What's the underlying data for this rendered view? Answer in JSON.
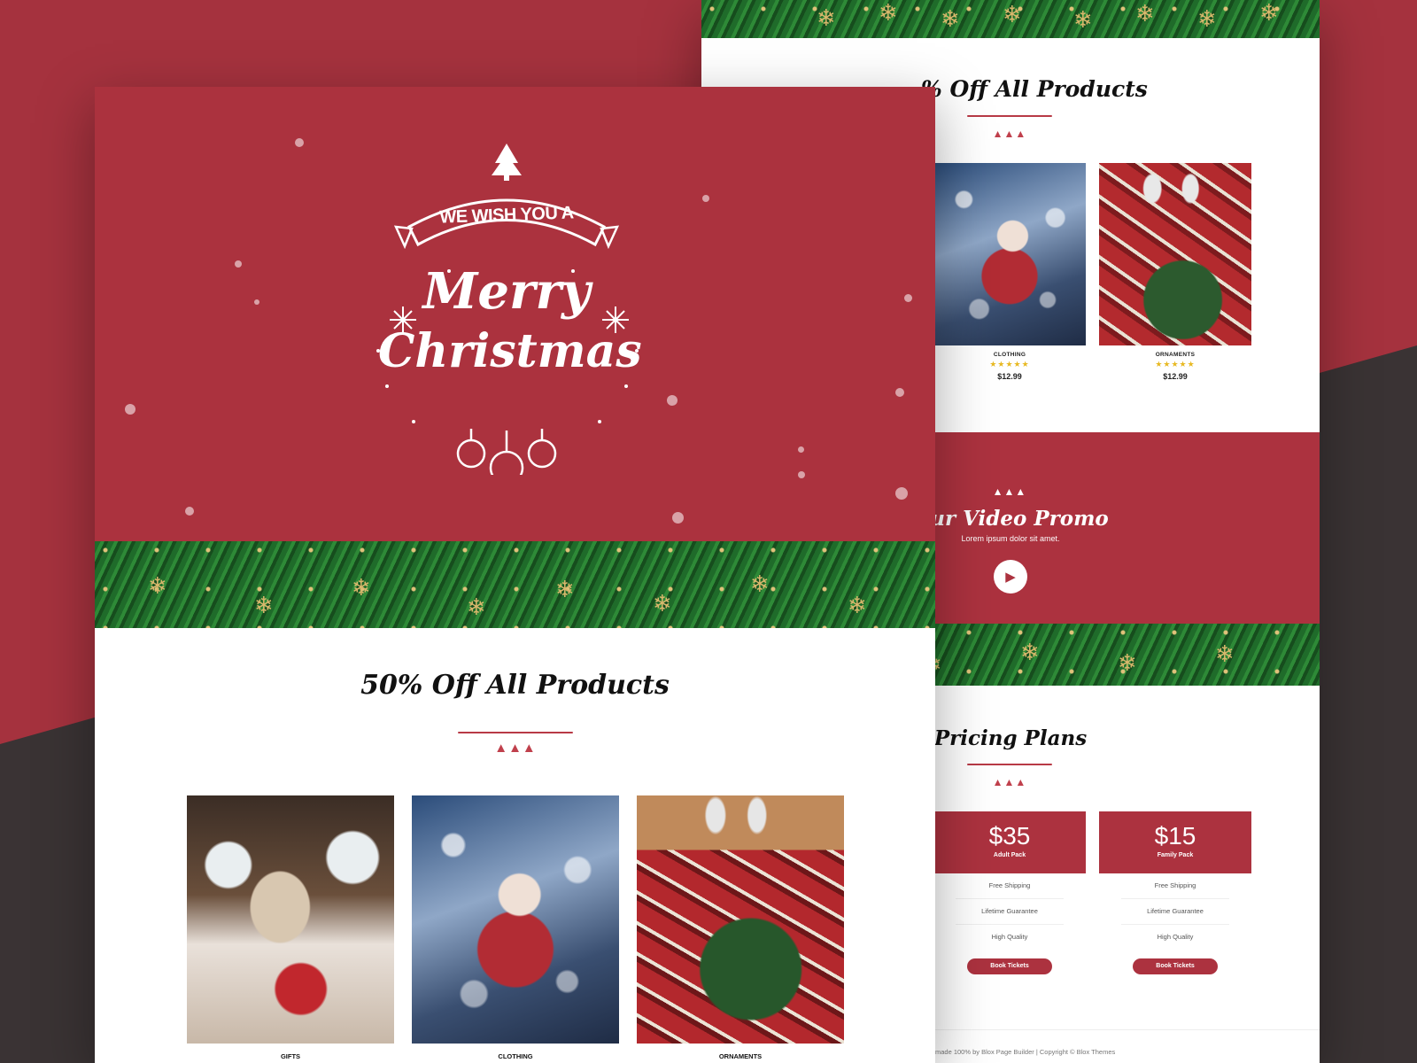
{
  "colors": {
    "brand_red": "#ab323e",
    "dark": "#3a3334",
    "gold": "#e8b923"
  },
  "back_page": {
    "sale_title": "% Off All Products",
    "products": [
      {
        "category": "CLOTHING",
        "rating": "★★★★★",
        "price": "$12.99"
      },
      {
        "category": "ORNAMENTS",
        "rating": "★★★★★",
        "price": "$12.99"
      }
    ],
    "video": {
      "title": "Our Video Promo",
      "subtitle": "Lorem ipsum dolor sit amet.",
      "play_icon": "play-icon"
    },
    "pricing": {
      "title": "Pricing Plans",
      "plans": [
        {
          "price": "$35",
          "name": "Adult Pack",
          "features": [
            "Free Shipping",
            "Lifetime Guarantee",
            "High Quality"
          ],
          "button": "Book Tickets"
        },
        {
          "price": "$15",
          "name": "Family Pack",
          "features": [
            "Free Shipping",
            "Lifetime Guarantee",
            "High Quality"
          ],
          "button": "Book Tickets"
        }
      ]
    },
    "footer": "made 100% by Blox Page Builder | Copyright © Blox Themes"
  },
  "front_page": {
    "hero": {
      "ribbon_text": "WE WISH YOU A",
      "line1": "Merry",
      "line2": "Christmas"
    },
    "sale_title": "50% Off All Products",
    "products": [
      {
        "category": "GIFTS"
      },
      {
        "category": "CLOTHING"
      },
      {
        "category": "ORNAMENTS"
      }
    ]
  }
}
